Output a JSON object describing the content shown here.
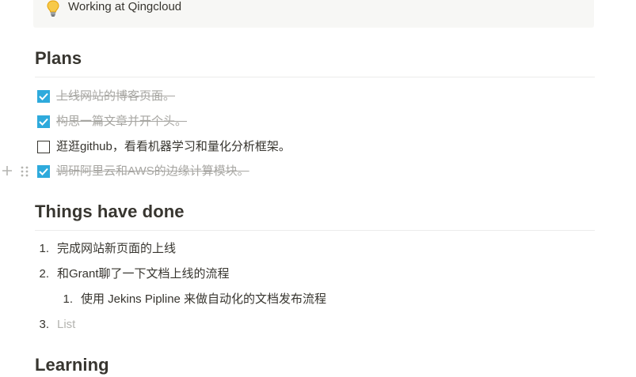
{
  "callout": {
    "icon": "lightbulb-icon",
    "text": "Working at Qingcloud"
  },
  "plans": {
    "title": "Plans",
    "todos": [
      {
        "text": "上线网站的博客页面。",
        "checked": true
      },
      {
        "text": "构思一篇文章并开个头。",
        "checked": true
      },
      {
        "text": "逛逛github，看看机器学习和量化分析框架。",
        "checked": false
      },
      {
        "text": "调研阿里云和AWS的边缘计算模块。",
        "checked": true
      }
    ]
  },
  "block_handles": {
    "plus_icon": "plus-icon",
    "drag_icon": "drag-handle-icon"
  },
  "done": {
    "title": "Things have done",
    "items": [
      {
        "num": "1.",
        "text": "完成网站新页面的上线"
      },
      {
        "num": "2.",
        "text": "和Grant聊了一下文档上线的流程"
      },
      {
        "num": "1.",
        "text": "使用 Jekins Pipline 来做自动化的文档发布流程"
      },
      {
        "num": "3.",
        "text": "List"
      }
    ]
  },
  "learning": {
    "title": "Learning"
  },
  "colors": {
    "accent": "#2eaadc",
    "text": "#37352f",
    "muted": "#a7a6a2",
    "callout_bg": "#f7f7f5"
  }
}
